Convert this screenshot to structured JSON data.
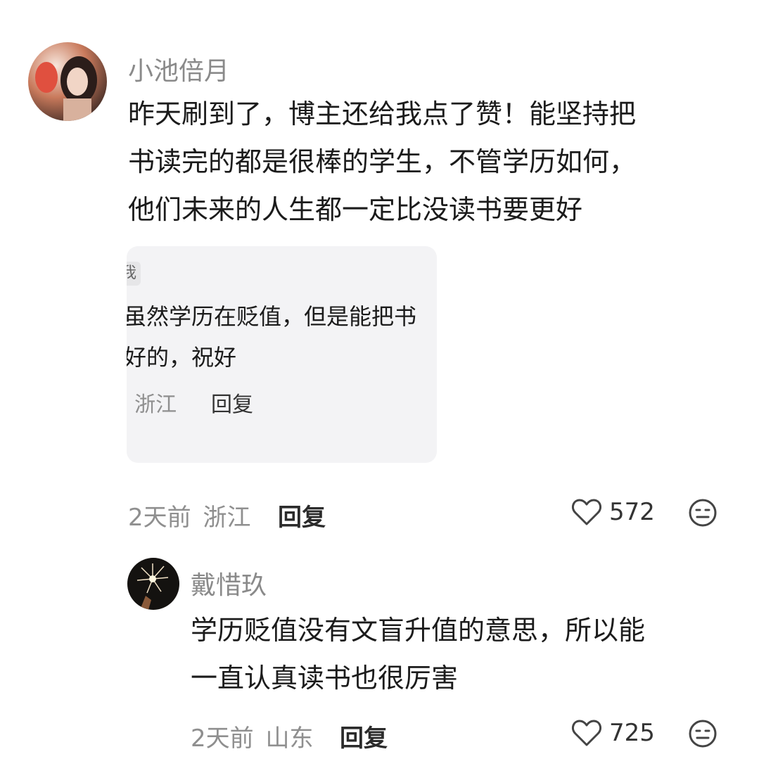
{
  "comments": [
    {
      "username": "小池倍月",
      "lines": [
        "昨天刷到了，博主还给我点了赞！能坚持把",
        "书读完的都是很棒的学生，不管学历如何，",
        "他们未来的人生都一定比没读书要更好"
      ],
      "time": "2天前",
      "location": "浙江",
      "reply_label": "回复",
      "likes": "572",
      "attached_card": {
        "tag": "我",
        "lines": [
          "虽然学历在贬值，但是能把书",
          "好的，祝好"
        ],
        "location": "浙江",
        "reply_label": "回复"
      }
    },
    {
      "username": "戴惜玖",
      "lines": [
        "学历贬值没有文盲升值的意思，所以能",
        "一直认真读书也很厉害"
      ],
      "time": "2天前",
      "location": "山东",
      "reply_label": "回复",
      "likes": "725"
    }
  ],
  "icons": {
    "like": "heart-outline-icon",
    "dislike": "neutral-face-icon"
  },
  "colors": {
    "meta": "#8f8f8f",
    "card_bg": "#f3f3f5"
  }
}
